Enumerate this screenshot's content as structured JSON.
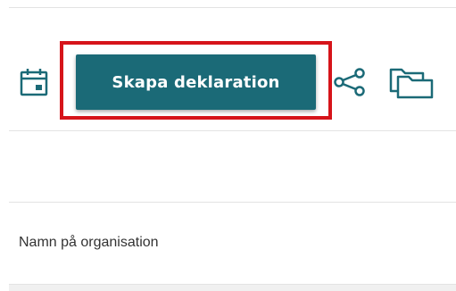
{
  "toolbar": {
    "primary_button_label": "Skapa deklaration",
    "icons": {
      "calendar": "calendar-icon",
      "share": "share-icon",
      "folders": "folders-icon"
    }
  },
  "form": {
    "organisation_name_label": "Namn på organisation"
  },
  "colors": {
    "accent": "#1b6a77",
    "highlight": "#d6141a",
    "icon": "#1b6a77"
  }
}
